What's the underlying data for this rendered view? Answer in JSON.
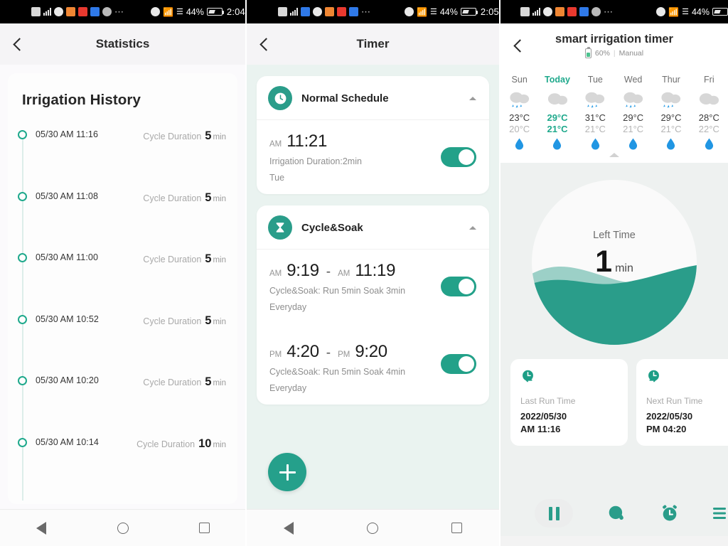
{
  "panel1": {
    "status_bar": {
      "battery_pct": "44%",
      "time": "2:04"
    },
    "nav": {
      "back_icon": "chevron-left-icon",
      "title": "Statistics"
    },
    "history": {
      "heading": "Irrigation History",
      "duration_label": "Cycle Duration",
      "unit": "min",
      "rows": [
        {
          "date": "05/30 AM 11:16",
          "label": "Cycle Duration",
          "value": "5",
          "unit": "min"
        },
        {
          "date": "05/30 AM 11:08",
          "label": "Cycle Duration",
          "value": "5",
          "unit": "min"
        },
        {
          "date": "05/30 AM 11:00",
          "label": "Cycle Duration",
          "value": "5",
          "unit": "min"
        },
        {
          "date": "05/30 AM 10:52",
          "label": "Cycle Duration",
          "value": "5",
          "unit": "min"
        },
        {
          "date": "05/30 AM 10:20",
          "label": "Cycle Duration",
          "value": "5",
          "unit": "min"
        },
        {
          "date": "05/30 AM 10:14",
          "label": "Cycle Duration",
          "value": "10",
          "unit": "min"
        }
      ]
    }
  },
  "panel2": {
    "status_bar": {
      "battery_pct": "44%",
      "time": "2:05"
    },
    "nav": {
      "back_icon": "chevron-left-icon",
      "title": "Timer"
    },
    "cards": [
      {
        "icon": "clock-icon",
        "title": "Normal Schedule",
        "collapse_icon": "caret-up-icon",
        "schedules": [
          {
            "start_ampm": "AM",
            "start_time": "11:21",
            "has_range": false,
            "desc": "Irrigation Duration:2min",
            "repeat": "Tue",
            "enabled": true
          }
        ]
      },
      {
        "icon": "hourglass-icon",
        "title": "Cycle&Soak",
        "collapse_icon": "caret-up-icon",
        "schedules": [
          {
            "start_ampm": "AM",
            "start_time": "9:19",
            "has_range": true,
            "dash": "-",
            "end_ampm": "AM",
            "end_time": "11:19",
            "desc": "Cycle&Soak: Run 5min Soak 3min",
            "repeat": "Everyday",
            "enabled": true
          },
          {
            "start_ampm": "PM",
            "start_time": "4:20",
            "has_range": true,
            "dash": "-",
            "end_ampm": "PM",
            "end_time": "9:20",
            "desc": "Cycle&Soak: Run 5min Soak 4min",
            "repeat": "Everyday",
            "enabled": true
          }
        ]
      }
    ],
    "fab": {
      "icon": "plus-icon",
      "label": "Add Schedule"
    }
  },
  "panel3": {
    "status_bar": {
      "battery_pct": "44%"
    },
    "nav": {
      "back_icon": "chevron-left-icon",
      "title": "smart irrigation timer",
      "battery_icon": "battery-icon",
      "battery_pct": "60%",
      "separator": "|",
      "mode": "Manual"
    },
    "weather": {
      "expand_icon": "caret-up-icon",
      "days": [
        {
          "day": "Sun",
          "is_today": false,
          "icon": "rain-cloud-icon",
          "high": "23°C",
          "low": "20°C",
          "drop_icon": "water-drop-icon"
        },
        {
          "day": "Today",
          "is_today": true,
          "icon": "cloud-icon",
          "high": "29°C",
          "low": "21°C",
          "drop_icon": "water-drop-icon"
        },
        {
          "day": "Tue",
          "is_today": false,
          "icon": "rain-cloud-icon",
          "high": "31°C",
          "low": "21°C",
          "drop_icon": "water-drop-icon"
        },
        {
          "day": "Wed",
          "is_today": false,
          "icon": "rain-cloud-icon",
          "high": "29°C",
          "low": "21°C",
          "drop_icon": "water-drop-icon"
        },
        {
          "day": "Thur",
          "is_today": false,
          "icon": "rain-cloud-icon",
          "high": "29°C",
          "low": "21°C",
          "drop_icon": "water-drop-icon"
        },
        {
          "day": "Fri",
          "is_today": false,
          "icon": "cloud-icon",
          "high": "28°C",
          "low": "22°C",
          "drop_icon": "water-drop-icon"
        }
      ]
    },
    "gauge": {
      "label": "Left Time",
      "value": "1",
      "unit": "min",
      "fill_color": "#2a9d8a"
    },
    "info_cards": [
      {
        "icon": "last-run-icon",
        "label": "Last Run Time",
        "date": "2022/05/30",
        "time": "AM 11:16"
      },
      {
        "icon": "next-run-icon",
        "label": "Next Run Time",
        "date": "2022/05/30",
        "time": "PM 04:20"
      }
    ],
    "toolbar": [
      {
        "icon": "pause-icon",
        "name": "pause-button"
      },
      {
        "icon": "water-drop-icon",
        "name": "manual-water-button"
      },
      {
        "icon": "alarm-clock-icon",
        "name": "timer-button"
      },
      {
        "icon": "list-icon",
        "name": "records-button"
      }
    ]
  },
  "theme": {
    "accent": "#2a9d8a",
    "accent_dark": "#1d9e86",
    "drop_blue": "#36a3e8"
  }
}
